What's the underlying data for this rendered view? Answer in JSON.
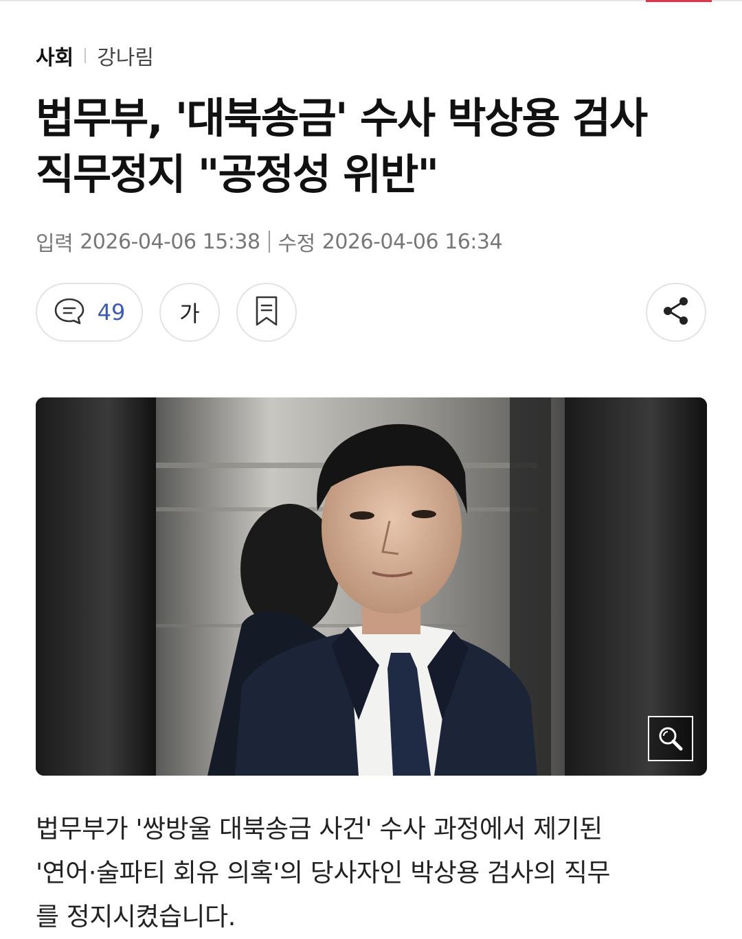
{
  "article": {
    "section": "사회",
    "author": "강나림",
    "headline_lines": [
      "법무부, '대북송금' 수사 박상용 검사",
      "직무정지 \"공정성 위반\""
    ],
    "published": {
      "label": "입력",
      "value": "2026-04-06 15:38"
    },
    "modified": {
      "label": "수정",
      "value": "2026-04-06 16:34"
    },
    "lead_lines": [
      "법무부가 '쌍방울 대북송금 사건' 수사 과정에서 제기된",
      "'연어·술파티 회유 의혹'의 당사자인 박상용 검사의 직무",
      "를 정지시켰습니다."
    ]
  },
  "toolbar": {
    "comment_count": "49",
    "font_size_label": "가",
    "icons": [
      "comment-icon",
      "bookmark-icon",
      "share-icon",
      "zoom-icon"
    ]
  },
  "colors": {
    "accent": "#e0364c",
    "comment_count": "#3b5bb0"
  }
}
